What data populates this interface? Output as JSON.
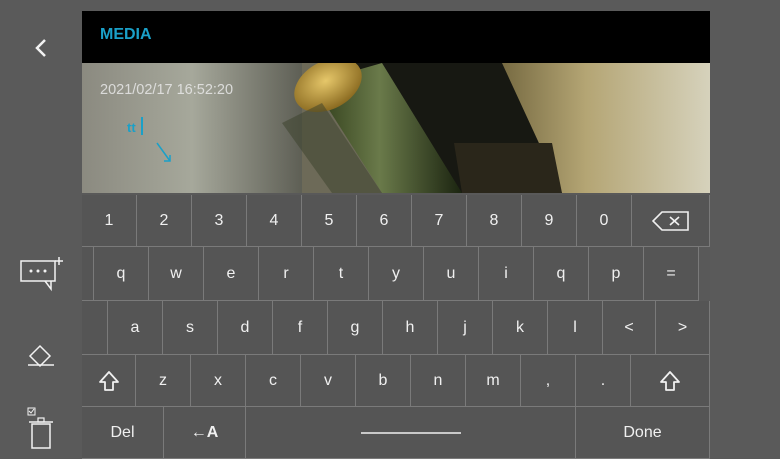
{
  "header": {
    "title": "MEDIA"
  },
  "image": {
    "timestamp": "2021/02/17 16:52:20",
    "annotation_text": "tt"
  },
  "sidebar": {
    "back_icon": "chevron-left-icon",
    "annotation_icon": "add-text-annotation-icon",
    "eraser_icon": "eraser-icon",
    "delete_icon": "trash-icon"
  },
  "keyboard": {
    "row1": [
      "1",
      "2",
      "3",
      "4",
      "5",
      "6",
      "7",
      "8",
      "9",
      "0"
    ],
    "row2": [
      "q",
      "w",
      "e",
      "r",
      "t",
      "y",
      "u",
      "i",
      "q",
      "p",
      "="
    ],
    "row3": [
      "a",
      "s",
      "d",
      "f",
      "g",
      "h",
      "j",
      "k",
      "l",
      "<",
      ">"
    ],
    "row4": [
      "z",
      "x",
      "c",
      "v",
      "b",
      "n",
      "m",
      ",",
      "."
    ],
    "del_label": "Del",
    "lang_label": "←A",
    "done_label": "Done"
  },
  "colors": {
    "accent": "#1aa0c8",
    "panel": "#5a5a5a",
    "key": "#555555"
  }
}
